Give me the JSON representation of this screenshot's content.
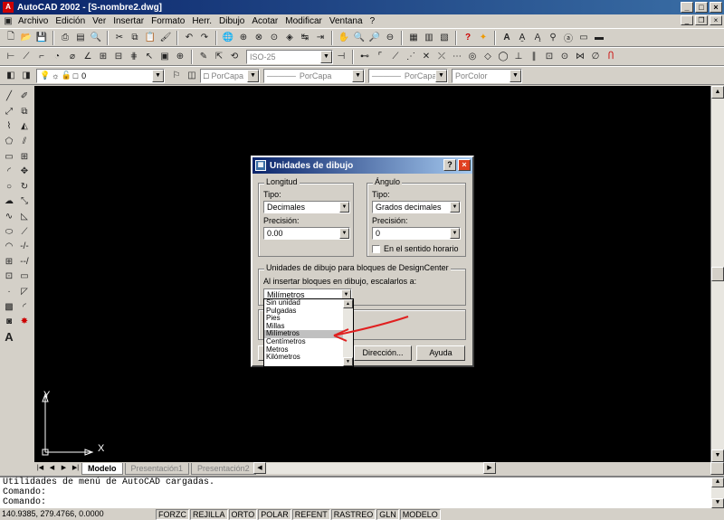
{
  "window": {
    "title": "AutoCAD 2002 - [S-nombre2.dwg]"
  },
  "menu": [
    "Archivo",
    "Edición",
    "Ver",
    "Insertar",
    "Formato",
    "Herr.",
    "Dibujo",
    "Acotar",
    "Modificar",
    "Ventana",
    "?"
  ],
  "toolbar_props": {
    "layer_value": "0",
    "color": "PorCapa",
    "linetype": "PorCapa",
    "lineweight": "PorCapa",
    "plotstyle": "PorColor",
    "dimstyle": "ISO-25"
  },
  "canvas": {
    "ucs_x": "X",
    "ucs_y": "Y"
  },
  "tabs": [
    "Modelo",
    "Presentación1",
    "Presentación2"
  ],
  "command": {
    "lines": [
      "Utilidades de menú de AutoCAD cargadas.",
      "Comando:",
      "Comando:"
    ]
  },
  "status": {
    "coords": "140.9385, 279.4766, 0.0000",
    "buttons": [
      "FORZC",
      "REJILLA",
      "ORTO",
      "POLAR",
      "REFENT",
      "RASTREO",
      "GLN",
      "MODELO"
    ]
  },
  "dialog": {
    "title": "Unidades de dibujo",
    "length": {
      "group_label": "Longitud",
      "type_label": "Tipo:",
      "type_value": "Decimales",
      "precision_label": "Precisión:",
      "precision_value": "0.00"
    },
    "angle": {
      "group_label": "Ángulo",
      "type_label": "Tipo:",
      "type_value": "Grados decimales",
      "precision_label": "Precisión:",
      "precision_value": "0",
      "clockwise_label": "En el sentido horario"
    },
    "designcenter": {
      "group_label": "Unidades de dibujo para bloques de DesignCenter",
      "prompt": "Al insertar bloques en dibujo, escalarlos a:",
      "value": "Milímetros",
      "options": [
        "Sin unidad",
        "Pulgadas",
        "Pies",
        "Millas",
        "Milímetros",
        "Centímetros",
        "Metros",
        "Kilómetros"
      ],
      "selected_index": 4
    },
    "buttons": {
      "direction": "Dirección...",
      "help": "Ayuda"
    }
  },
  "colors": {
    "canvas": "#000000",
    "annotation_arrow": "#e02020",
    "title_bar": "#0a246a"
  }
}
